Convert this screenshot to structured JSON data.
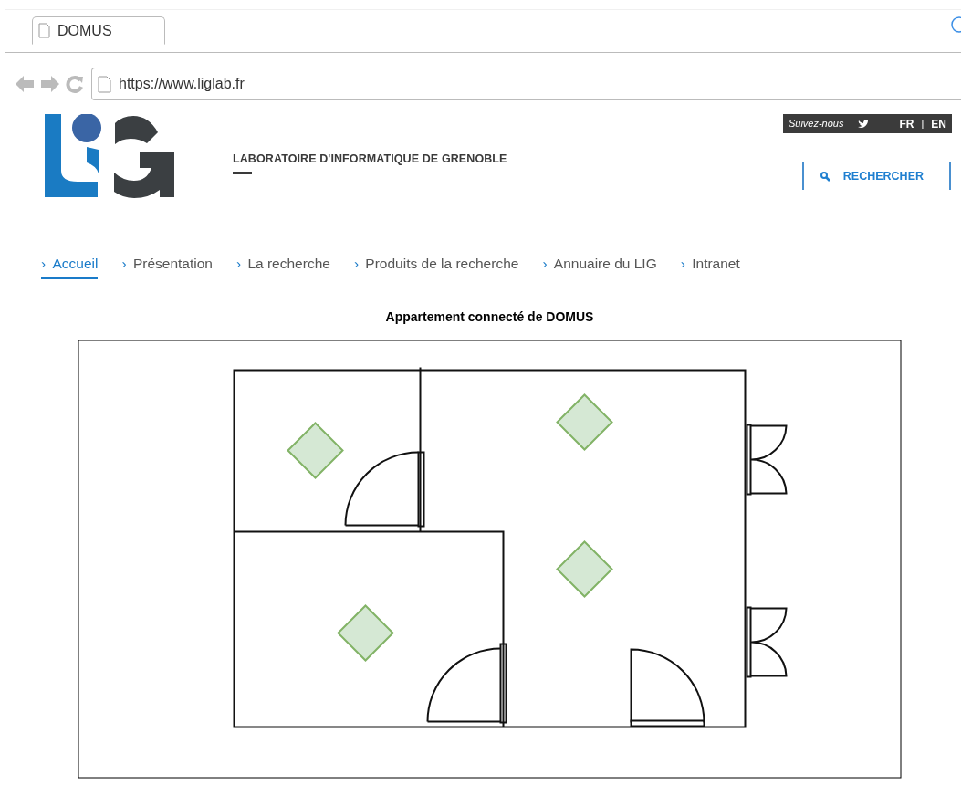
{
  "browser": {
    "tab_title": "DOMUS",
    "url": "https://www.liglab.fr"
  },
  "header": {
    "lab_name": "LABORATOIRE D'INFORMATIQUE DE GRENOBLE",
    "follow_label": "Suivez-nous",
    "languages": [
      "FR",
      "EN"
    ],
    "language_separator": "|",
    "search_label": "RECHERCHER"
  },
  "nav": [
    {
      "marker": "›",
      "label": "Accueil",
      "selected": true
    },
    {
      "marker": "›",
      "label": "Présentation",
      "selected": false
    },
    {
      "marker": "›",
      "label": "La recherche",
      "selected": false
    },
    {
      "marker": "›",
      "label": "Produits de la recherche",
      "selected": false
    },
    {
      "marker": "›",
      "label": "Annuaire du LIG",
      "selected": false
    },
    {
      "marker": "›",
      "label": "Intranet",
      "selected": false
    }
  ],
  "figure": {
    "title": "Appartement connecté de DOMUS"
  }
}
